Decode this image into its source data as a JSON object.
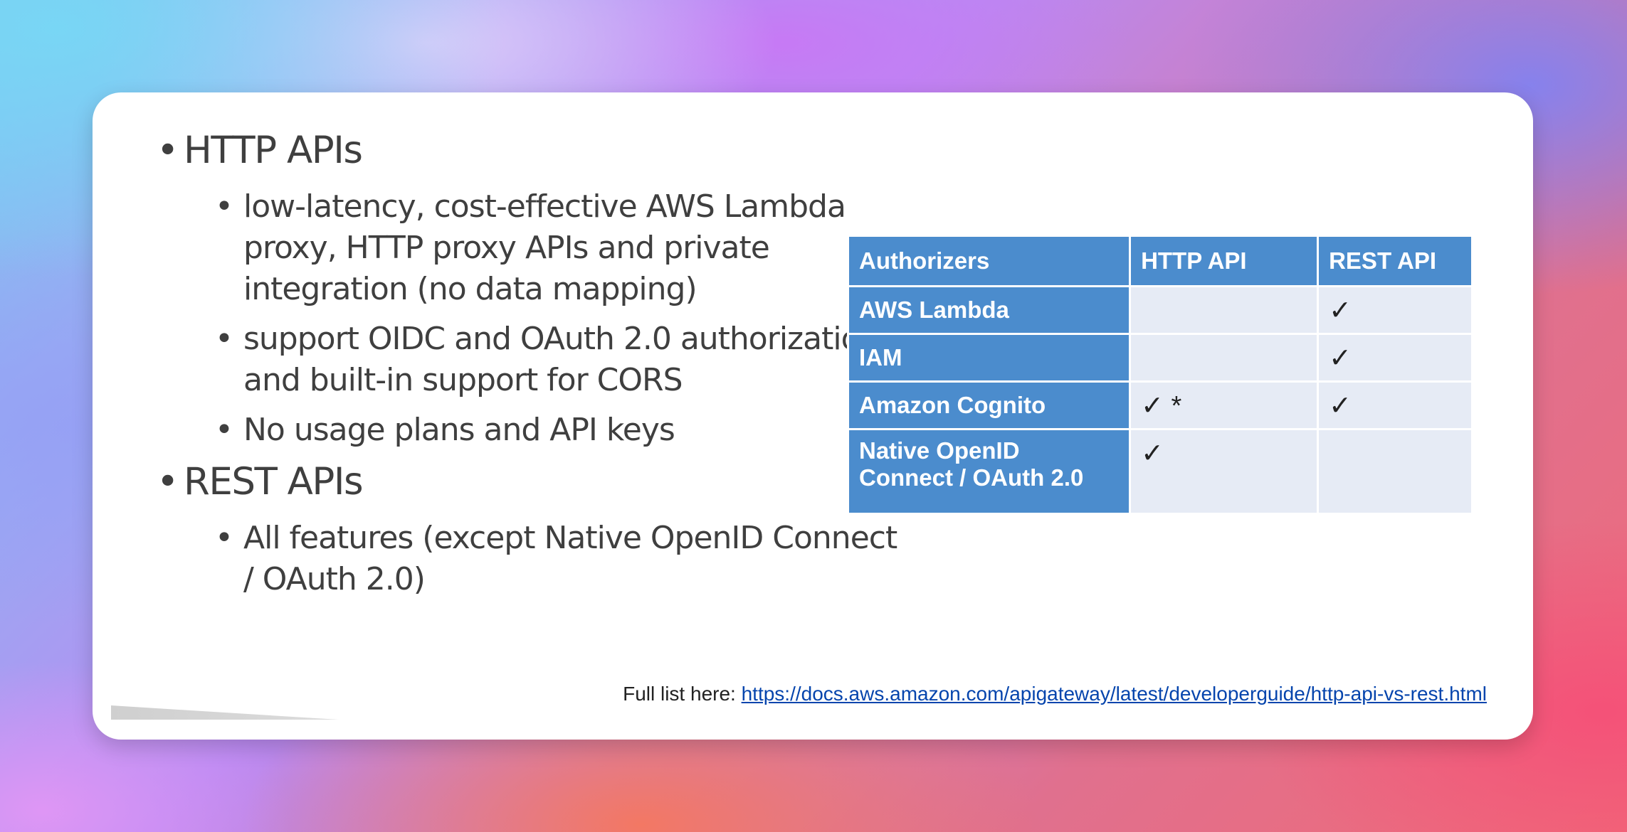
{
  "slide": {
    "bullets": [
      {
        "text": "HTTP APIs",
        "sub": [
          "low-latency, cost-effective AWS Lambda proxy, HTTP proxy APIs and private integration (no data mapping)",
          "support OIDC and OAuth 2.0 authorization, and built-in support for CORS",
          "No usage plans and API keys"
        ]
      },
      {
        "text": "REST APIs",
        "sub": [
          "All features (except Native OpenID Connect / OAuth 2.0)"
        ]
      }
    ],
    "bullet_char": "•",
    "table": {
      "headers": [
        "Authorizers",
        "HTTP API",
        "REST API"
      ],
      "rows": [
        [
          "AWS Lambda",
          "",
          "✓"
        ],
        [
          "IAM",
          "",
          "✓"
        ],
        [
          "Amazon Cognito",
          "✓ *",
          "✓"
        ],
        [
          "Native OpenID Connect / OAuth 2.0",
          "✓",
          ""
        ]
      ]
    },
    "footer": {
      "label": "Full list here: ",
      "link": "https://docs.aws.amazon.com/apigateway/latest/developerguide/http-api-vs-rest.html"
    }
  },
  "colors": {
    "table_header": "#4b8ccd",
    "table_cell": "#e6ebf5",
    "link": "#0645ad",
    "text": "#3f3f3f"
  }
}
